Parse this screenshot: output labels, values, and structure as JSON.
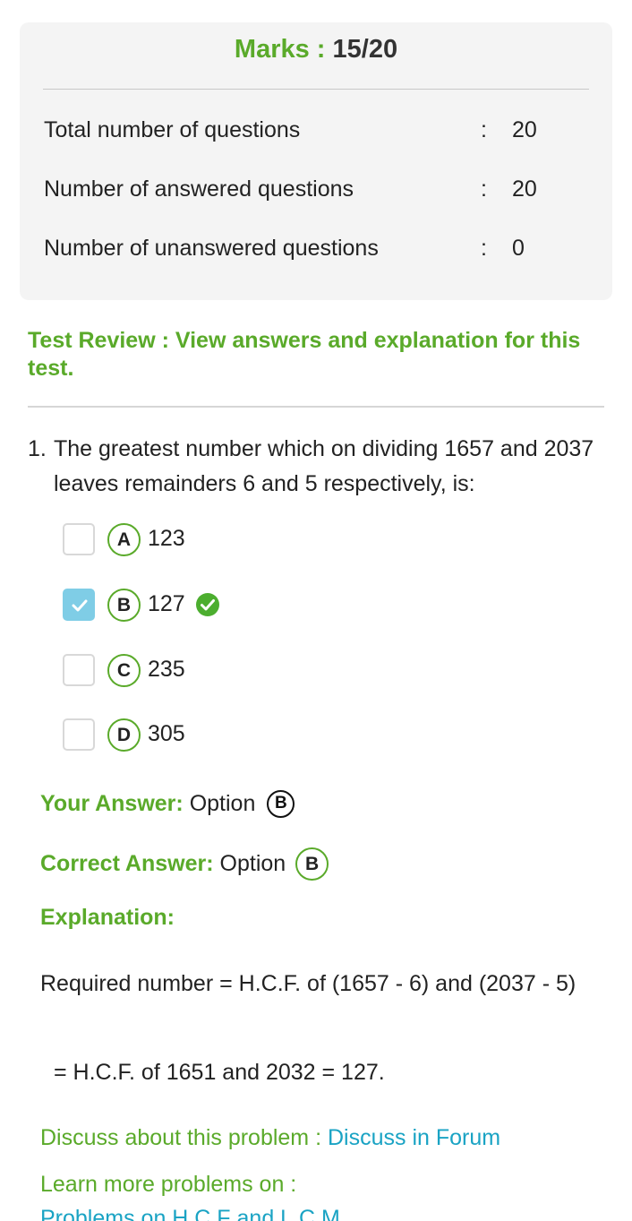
{
  "summary": {
    "marks_label": "Marks : ",
    "marks_value": "15/20",
    "stats": [
      {
        "label": "Total number of questions",
        "colon": ":",
        "value": "20"
      },
      {
        "label": "Number of answered questions",
        "colon": ":",
        "value": "20"
      },
      {
        "label": "Number of unanswered questions",
        "colon": ":",
        "value": "0"
      }
    ]
  },
  "review": {
    "heading": "Test Review : View answers and explanation for this test."
  },
  "question": {
    "number": "1.",
    "text": "The greatest number which on dividing 1657 and 2037 leaves remainders 6 and 5 respectively, is:",
    "options": [
      {
        "letter": "A",
        "text": "123",
        "checked": false
      },
      {
        "letter": "B",
        "text": "127",
        "checked": true,
        "correct": true
      },
      {
        "letter": "C",
        "text": "235",
        "checked": false
      },
      {
        "letter": "D",
        "text": "305",
        "checked": false
      }
    ]
  },
  "answer": {
    "your_label": "Your Answer:",
    "your_text": " Option ",
    "your_option": "B",
    "correct_label": "Correct Answer:",
    "correct_text": " Option ",
    "correct_option": "B"
  },
  "explanation": {
    "heading": "Explanation:",
    "line1": "Required number = H.C.F. of (1657 - 6) and (2037 - 5)",
    "line2": "= H.C.F. of 1651 and 2032 = 127."
  },
  "footer": {
    "discuss_label": "Discuss about this problem : ",
    "discuss_link": "Discuss in Forum",
    "learn_label": "Learn more problems on :",
    "topic_link": "Problems on H.C.F and L.C.M"
  },
  "colors": {
    "accent_green": "#5aaa2a",
    "link_blue": "#1aa3c4",
    "checkbox_checked": "#7fcde6"
  },
  "icons": {
    "check": "checkmark-icon",
    "correct": "correct-check-circle-icon"
  }
}
